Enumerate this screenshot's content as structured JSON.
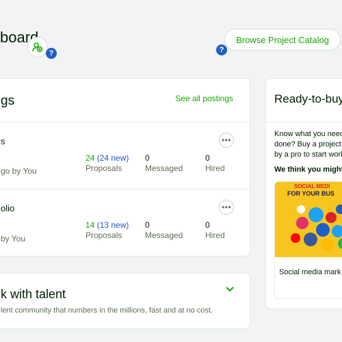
{
  "header": {
    "title_fragment": "board",
    "catalog_button": "Browse Project Catalog",
    "help_symbol": "?",
    "icons": [
      "add-team-icon",
      "help-icon"
    ]
  },
  "postings": {
    "title_fragment": "gs",
    "see_all": "See all postings",
    "items": [
      {
        "name_fragment": "s",
        "meta_fragment": "go by You",
        "proposals_count": "24",
        "proposals_new": "(24 new)",
        "proposals_label": "Proposals",
        "messaged_count": "0",
        "messaged_label": "Messaged",
        "hired_count": "0",
        "hired_label": "Hired",
        "menu_symbol": "•••"
      },
      {
        "name_fragment": "olio",
        "meta_fragment": "by You",
        "proposals_count": "14",
        "proposals_new": "(13 new)",
        "proposals_label": "Proposals",
        "messaged_count": "0",
        "messaged_label": "Messaged",
        "hired_count": "0",
        "hired_label": "Hired",
        "menu_symbol": "•••"
      }
    ]
  },
  "talent": {
    "title_fragment": "k with talent",
    "description_fragment": "lent community that numbers in the millions, fast and at no cost."
  },
  "ready": {
    "title_fragment": "Ready-to-buy",
    "text_line1": "Know what you need",
    "text_line2": "done? Buy a project",
    "text_line3": "by a pro to start work",
    "suggestion": "We think you might l",
    "promo_heading1": "SOCIAL MEDI",
    "promo_heading2": "FOR YOUR BUS",
    "promo_label": "Social media mark"
  },
  "colors": {
    "brand_green": "#14a800",
    "link_blue": "#1f57c3",
    "help_blue": "#1d5fc6",
    "promo_yellow": "#f7c51f"
  }
}
